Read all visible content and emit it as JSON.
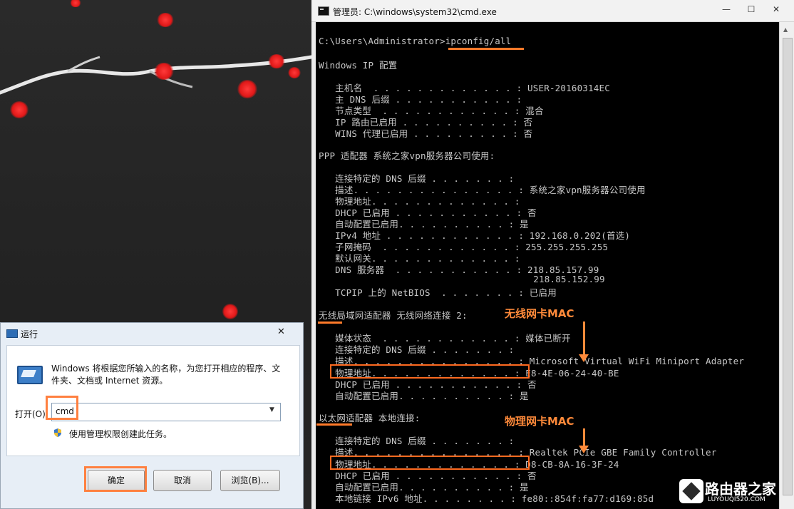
{
  "cmd": {
    "title": "管理员: C:\\windows\\system32\\cmd.exe",
    "window_buttons": [
      "—",
      "☐",
      "✕"
    ],
    "lines": [
      "C:\\Users\\Administrator>ipconfig/all",
      "Windows IP 配置",
      "   主机名  . . . . . . . . . . . . . : USER-20160314EC",
      "   主 DNS 后缀 . . . . . . . . . . . :",
      "   节点类型  . . . . . . . . . . . . : 混合",
      "   IP 路由已启用 . . . . . . . . . . : 否",
      "   WINS 代理已启用 . . . . . . . . . : 否",
      "PPP 适配器 系统之家vpn服务器公司使用:",
      "   连接特定的 DNS 后缀 . . . . . . . :",
      "   描述. . . . . . . . . . . . . . . : 系统之家vpn服务器公司使用",
      "   物理地址. . . . . . . . . . . . . :",
      "   DHCP 已启用 . . . . . . . . . . . : 否",
      "   自动配置已启用. . . . . . . . . . : 是",
      "   IPv4 地址 . . . . . . . . . . . . : 192.168.0.202(首选)",
      "   子网掩码  . . . . . . . . . . . . : 255.255.255.255",
      "   默认网关. . . . . . . . . . . . . :",
      "   DNS 服务器  . . . . . . . . . . . : 218.85.157.99",
      "                                       218.85.152.99",
      "   TCPIP 上的 NetBIOS  . . . . . . . : 已启用",
      "无线局域网适配器 无线网络连接 2:",
      "   媒体状态  . . . . . . . . . . . . : 媒体已断开",
      "   连接特定的 DNS 后缀 . . . . . . . :",
      "   描述. . . . . . . . . . . . . . . : Microsoft Virtual WiFi Miniport Adapter",
      "   物理地址. . . . . . . . . . . . . : E8-4E-06-24-40-BE",
      "   DHCP 已启用 . . . . . . . . . . . : 否",
      "   自动配置已启用. . . . . . . . . . : 是",
      "以太网适配器 本地连接:",
      "   连接特定的 DNS 后缀 . . . . . . . :",
      "   描述. . . . . . . . . . . . . . . : Realtek PCIe GBE Family Controller",
      "   物理地址. . . . . . . . . . . . . : D8-CB-8A-16-3F-24",
      "   DHCP 已启用 . . . . . . . . . . . : 否",
      "   自动配置已启用. . . . . . . . . . : 是",
      "   本地链接 IPv6 地址. . . . . . . . : fe80::854f:fa77:d169:85d"
    ]
  },
  "annotations": {
    "wifi_mac_label": "无线网卡MAC",
    "physical_mac_label": "物理网卡MAC"
  },
  "run_dialog": {
    "title": "运行",
    "close": "✕",
    "description": "Windows 将根据您所输入的名称，为您打开相应的程序、文件夹、文档或 Internet 资源。",
    "open_label": "打开(O):",
    "input_value": "cmd",
    "admin_note": "使用管理权限创建此任务。",
    "ok_label": "确定",
    "cancel_label": "取消",
    "browse_label": "浏览(B)..."
  },
  "watermark": {
    "text": "路由器之家",
    "sub": "LUYOUQI520.COM"
  },
  "colors": {
    "accent_annotation": "#ff8a3a",
    "cmd_text": "#c7c7c7",
    "cmd_background": "#000000"
  }
}
